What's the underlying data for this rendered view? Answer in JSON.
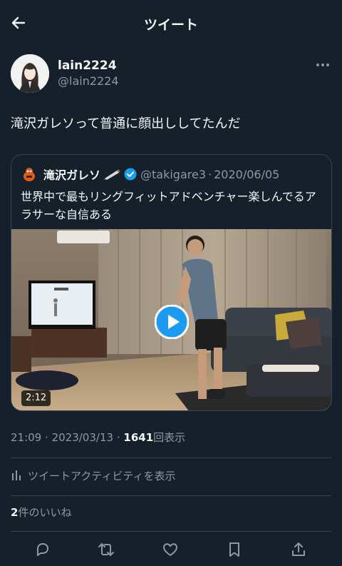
{
  "header": {
    "title": "ツイート",
    "back_icon": "arrow-left-icon"
  },
  "author": {
    "display_name": "lain2224",
    "handle": "@lain2224"
  },
  "tweet": {
    "text": "滝沢ガレソって普通に顔出ししてたんだ"
  },
  "quote": {
    "display_name": "滝沢ガレソ",
    "handle": "@takigare3",
    "separator": "·",
    "date": "2020/06/05",
    "text": "世界中で最もリングフィットアドベンチャー楽しんでるアラサーな自信ある",
    "video_duration": "2:12"
  },
  "meta": {
    "time": "21:09",
    "sep1": "·",
    "date": "2023/03/13",
    "sep2": "·",
    "views_count": "1641",
    "views_label": "回表示"
  },
  "activity": {
    "label": "ツイートアクティビティを表示"
  },
  "likes": {
    "count": "2",
    "label": "件のいいね"
  },
  "colors": {
    "background": "#15202b",
    "text": "#f7f9f9",
    "secondary": "#8b98a5",
    "divider": "#38444d",
    "accent": "#1d9bf0"
  },
  "icons": {
    "actions": [
      "reply-icon",
      "retweet-icon",
      "like-icon",
      "bookmark-icon",
      "share-icon"
    ]
  }
}
